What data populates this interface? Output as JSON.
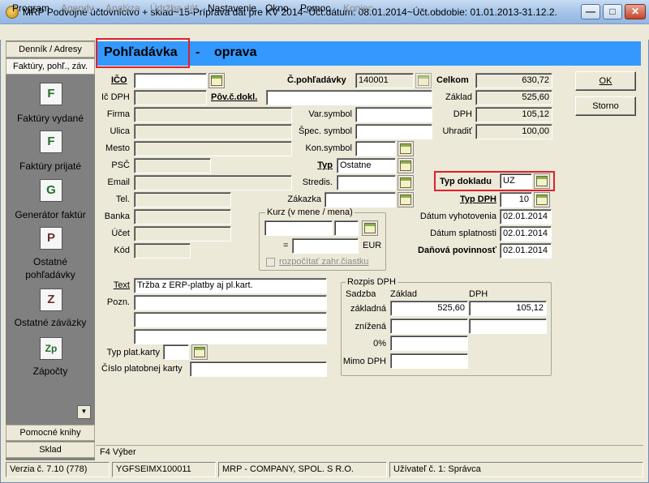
{
  "window": {
    "title": "MRP Podvojné účtovníctvo + sklad~15-Príprava dát pre KV 2014~Účt.dátum: 08.01.2014~Účt.obdobie: 01.01.2013-31.12.2...",
    "minimize": "—",
    "maximize": "□",
    "close": "✕"
  },
  "menu": [
    {
      "label": "Program",
      "enabled": true
    },
    {
      "label": "Agendy",
      "enabled": false
    },
    {
      "label": "Analýza",
      "enabled": false
    },
    {
      "label": "Údržba dát",
      "enabled": false
    },
    {
      "label": "Nastavenie",
      "enabled": true
    },
    {
      "label": "Okno",
      "enabled": true
    },
    {
      "label": "Pomoc",
      "enabled": true
    },
    {
      "label": "Koniec",
      "enabled": false
    }
  ],
  "sidebar": {
    "top_buttons": [
      "Denník / Adresy",
      "Faktúry, pohľ., záv."
    ],
    "items": [
      {
        "label": "Faktúry vydané",
        "icon": "invoice-issued-icon",
        "glyph": "F"
      },
      {
        "label": "Faktúry prijaté",
        "icon": "invoice-received-icon",
        "glyph": "F"
      },
      {
        "label": "Generátor faktúr",
        "icon": "invoice-generator-icon",
        "glyph": "G"
      },
      {
        "label": "Ostatné pohľadávky",
        "icon": "other-receivables-icon",
        "glyph": "P"
      },
      {
        "label": "Ostatné záväzky",
        "icon": "other-payables-icon",
        "glyph": "Z"
      },
      {
        "label": "Zápočty",
        "icon": "offsets-icon",
        "glyph": "Zp"
      }
    ],
    "bottom_buttons": [
      "Pomocné knihy",
      "Sklad"
    ],
    "scroll_glyph": "▼"
  },
  "banner": {
    "title": "Pohľadávka",
    "dash": "-",
    "mode": "oprava"
  },
  "form": {
    "ico_label": "IČO",
    "ico_value": "",
    "ic_dph_label": "Ič DPH",
    "firma_label": "Firma",
    "ulica_label": "Ulica",
    "mesto_label": "Mesto",
    "psc_label": "PSČ",
    "email_label": "Email",
    "tel_label": "Tel.",
    "banka_label": "Banka",
    "ucet_label": "Účet",
    "kod_label": "Kód",
    "cislo_pohladavky_label": "Č.pohľadávky",
    "cislo_pohladavky_value": "140001",
    "povodne_cislo_label": "Pôv.č.dokl.",
    "var_symbol_label": "Var.symbol",
    "spec_symbol_label": "Špec. symbol",
    "kon_symbol_label": "Kon.symbol",
    "typ_label": "Typ",
    "typ_value": "Ostatne",
    "stredis_label": "Stredis.",
    "zakazka_label": "Zákazka",
    "kurz_title": "Kurz (v mene / mena)",
    "kurz_eq": "=",
    "kurz_currency": "EUR",
    "kurz_checkbox_label": "rozpočítať zahr.čiastku",
    "celkom_label": "Celkom",
    "celkom_value": "630,72",
    "zaklad_label": "Základ",
    "zaklad_value": "525,60",
    "dph_label": "DPH",
    "dph_value": "105,12",
    "uhradit_label": "Uhradiť",
    "uhradit_value": "100,00",
    "typ_dokladu_label": "Typ dokladu",
    "typ_dokladu_value": "UZ",
    "typ_dph_label": "Typ DPH",
    "typ_dph_value": "10",
    "datum_vyhotovenia_label": "Dátum vyhotovenia",
    "datum_vyhotovenia_value": "02.01.2014",
    "datum_splatnosti_label": "Dátum splatnosti",
    "datum_splatnosti_value": "02.01.2014",
    "danova_povinnost_label": "Daňová povinnosť",
    "danova_povinnost_value": "02.01.2014",
    "text_label": "Text",
    "text_value": "Tržba z ERP-platby aj pl.kart.",
    "pozn_label": "Pozn.",
    "typ_plat_karty_label": "Typ plat.karty",
    "cislo_karty_label": "Číslo platobnej karty"
  },
  "rozpis": {
    "title": "Rozpis DPH",
    "col_sadzba": "Sadzba",
    "col_zaklad": "Základ",
    "col_dph": "DPH",
    "rows": [
      {
        "label": "základná",
        "zaklad": "525,60",
        "dph": "105,12"
      },
      {
        "label": "znížená",
        "zaklad": "",
        "dph": ""
      },
      {
        "label": "0%",
        "zaklad": "",
        "dph": ""
      },
      {
        "label": "Mimo DPH",
        "zaklad": "",
        "dph": ""
      }
    ]
  },
  "buttons": {
    "ok": "OK",
    "storno": "Storno"
  },
  "hint": "F4 Výber",
  "status": {
    "version": "Verzia č. 7.10 (778)",
    "code": "YGFSEIMX100011",
    "company": "MRP - COMPANY, SPOL. S R.O.",
    "user": "Užívateľ č. 1: Správca"
  },
  "colors": {
    "banner": "#3399ff",
    "highlight": "#e0202a",
    "sidebar_bg": "#808080"
  }
}
